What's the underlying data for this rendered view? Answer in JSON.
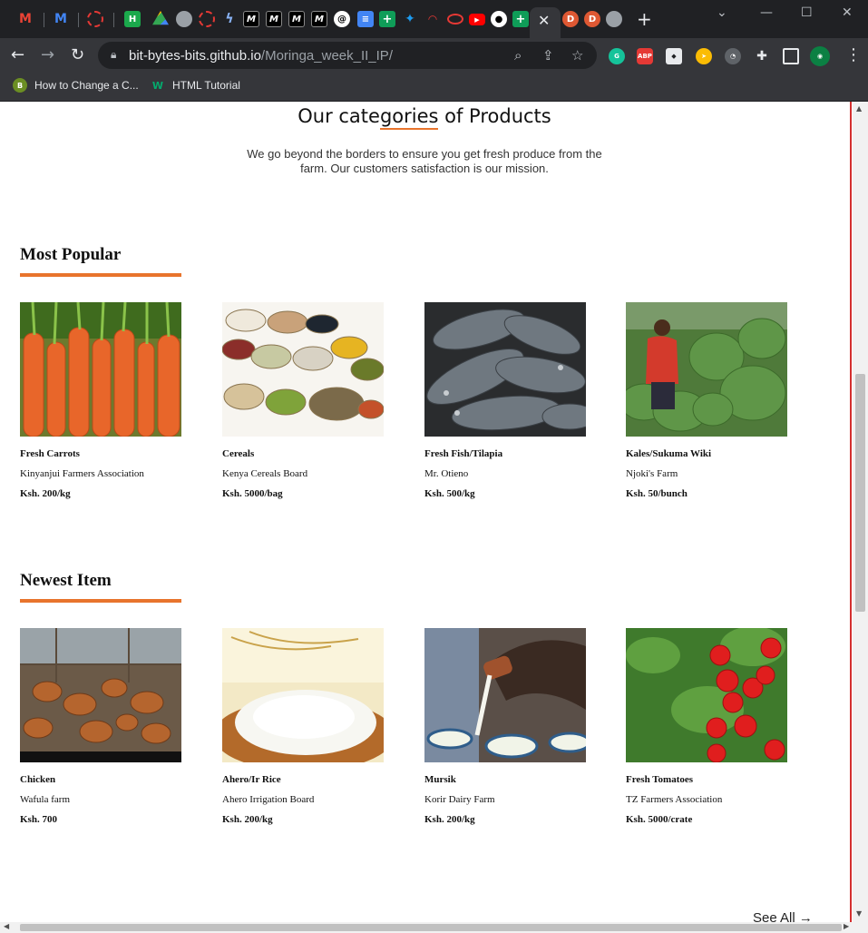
{
  "browser": {
    "url_host": "bit-bytes-bits.github.io",
    "url_path": "/Moringa_week_II_IP/",
    "bookmarks": [
      {
        "label": "How to Change a C...",
        "icon": "blogger-icon"
      },
      {
        "label": "HTML Tutorial",
        "icon": "w3schools-icon"
      }
    ],
    "extension_labels": {
      "abp": "ABP"
    }
  },
  "page": {
    "categories_title_pre": "Our cate",
    "categories_title_mid": "gories",
    "categories_title_post": " of Products",
    "categories_subtitle": "We go beyond the borders to ensure you get fresh produce from the farm. Our customers satisfaction is our mission.",
    "see_all": "See All →",
    "sections": [
      {
        "title": "Most Popular",
        "items": [
          {
            "name": "Fresh Carrots",
            "seller": "Kinyanjui Farmers Association",
            "price": "Ksh. 200/kg"
          },
          {
            "name": "Cereals",
            "seller": "Kenya Cereals Board",
            "price": "Ksh. 5000/bag"
          },
          {
            "name": "Fresh Fish/Tilapia",
            "seller": "Mr. Otieno",
            "price": "Ksh. 500/kg"
          },
          {
            "name": "Kales/Sukuma Wiki",
            "seller": "Njoki's Farm",
            "price": "Ksh. 50/bunch"
          }
        ]
      },
      {
        "title": "Newest Item",
        "items": [
          {
            "name": "Chicken",
            "seller": "Wafula farm",
            "price": "Ksh. 700"
          },
          {
            "name": "Ahero/Ir Rice",
            "seller": "Ahero Irrigation Board",
            "price": "Ksh. 200/kg"
          },
          {
            "name": "Mursik",
            "seller": "Korir Dairy Farm",
            "price": "Ksh. 200/kg"
          },
          {
            "name": "Fresh Tomatoes",
            "seller": "TZ Farmers Association",
            "price": "Ksh. 5000/crate"
          }
        ]
      }
    ]
  },
  "colors": {
    "accent": "#e8742c",
    "chrome_dark": "#202124",
    "chrome_toolbar": "#35363a",
    "scroll_marker": "#d32f2f"
  }
}
